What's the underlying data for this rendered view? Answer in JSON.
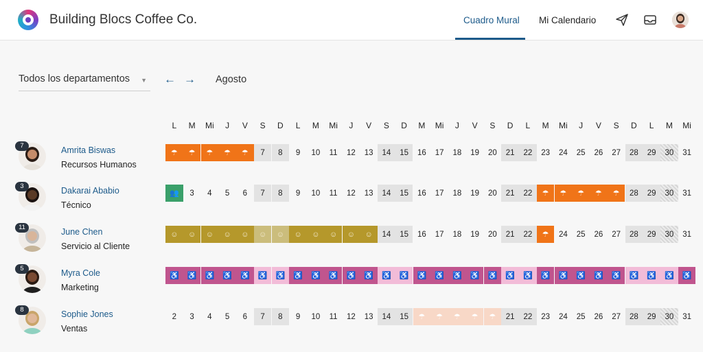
{
  "app": {
    "title": "Building Blocs Coffee Co."
  },
  "nav": {
    "tabs": [
      {
        "label": "Cuadro Mural"
      },
      {
        "label": "Mi Calendario"
      }
    ]
  },
  "toolbar": {
    "department_filter": "Todos los departamentos",
    "month": "Agosto"
  },
  "day_headers": [
    "L",
    "M",
    "Mi",
    "J",
    "V",
    "S",
    "D",
    "L",
    "M",
    "Mi",
    "J",
    "V",
    "S",
    "D",
    "M",
    "Mi",
    "J",
    "V",
    "S",
    "D",
    "L",
    "M",
    "Mi",
    "J",
    "V",
    "S",
    "D",
    "L",
    "M",
    "Mi"
  ],
  "employees": [
    {
      "badge": "7",
      "name": "Amrita Biswas",
      "department": "Recursos Humanos",
      "days": [
        "",
        "",
        "",
        "",
        "",
        "7",
        "8",
        "9",
        "10",
        "11",
        "12",
        "13",
        "14",
        "15",
        "16",
        "17",
        "18",
        "19",
        "20",
        "21",
        "22",
        "23",
        "24",
        "25",
        "26",
        "27",
        "28",
        "29",
        "30",
        "31"
      ]
    },
    {
      "badge": "3",
      "name": "Dakarai Ababio",
      "department": "Técnico",
      "days": [
        "",
        "3",
        "4",
        "5",
        "6",
        "7",
        "8",
        "9",
        "10",
        "11",
        "12",
        "13",
        "14",
        "15",
        "16",
        "17",
        "18",
        "19",
        "20",
        "21",
        "22",
        "",
        "",
        "",
        "",
        "",
        "28",
        "29",
        "30",
        "31"
      ]
    },
    {
      "badge": "11",
      "name": "June Chen",
      "department": "Servicio al Cliente",
      "days": [
        "",
        "",
        "",
        "",
        "",
        "",
        "",
        "",
        "",
        "",
        "",
        "",
        "14",
        "15",
        "16",
        "17",
        "18",
        "19",
        "20",
        "21",
        "22",
        "",
        "24",
        "25",
        "26",
        "27",
        "28",
        "29",
        "30",
        "31"
      ]
    },
    {
      "badge": "5",
      "name": "Myra Cole",
      "department": "Marketing",
      "days": [
        "",
        "",
        "",
        "",
        "",
        "",
        "",
        "",
        "",
        "",
        "",
        "",
        "",
        "",
        "",
        "",
        "",
        "",
        "",
        "",
        "",
        "",
        "",
        "",
        "",
        "",
        "",
        "",
        "",
        ""
      ]
    },
    {
      "badge": "8",
      "name": "Sophie Jones",
      "department": "Ventas",
      "days": [
        "2",
        "3",
        "4",
        "5",
        "6",
        "7",
        "8",
        "9",
        "10",
        "11",
        "12",
        "13",
        "14",
        "15",
        "",
        "",
        "",
        "",
        "",
        "21",
        "22",
        "23",
        "24",
        "25",
        "26",
        "27",
        "28",
        "29",
        "30",
        "31"
      ]
    }
  ],
  "colors": {
    "accent": "#1c5a8a",
    "vacation": "#f07418",
    "sick": "#b5982b",
    "parental": "#c0558e",
    "meeting": "#3aa06a"
  }
}
